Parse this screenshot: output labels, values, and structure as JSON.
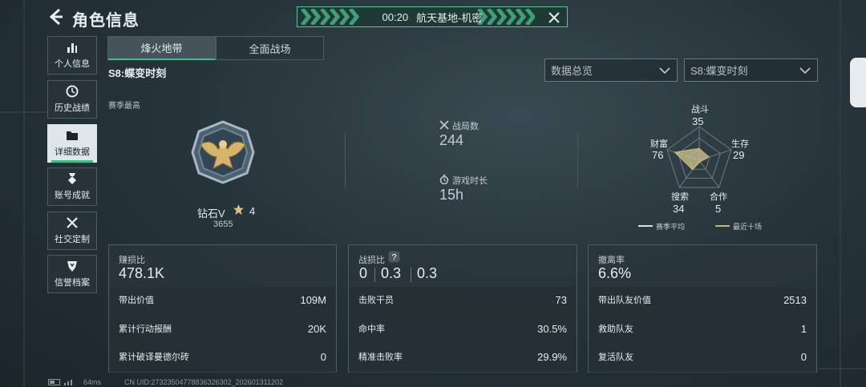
{
  "header": {
    "title": "角色信息"
  },
  "banner": {
    "time": "00:20",
    "location": "航天基地-机密"
  },
  "sidebar": {
    "items": [
      {
        "label": "个人信息",
        "icon": "bar-chart-icon"
      },
      {
        "label": "历史战绩",
        "icon": "clock-icon"
      },
      {
        "label": "详细数据",
        "icon": "folder-icon",
        "active": true
      },
      {
        "label": "账号成就",
        "icon": "medal-icon"
      },
      {
        "label": "社交定制",
        "icon": "tools-icon"
      },
      {
        "label": "信誉档案",
        "icon": "shield-icon"
      }
    ]
  },
  "tabs": [
    {
      "label": "烽火地带",
      "active": true
    },
    {
      "label": "全面战场"
    }
  ],
  "season_title": "S8:蝶变时刻",
  "dropdowns": {
    "data_view": "数据总览",
    "season": "S8:蝶变时刻"
  },
  "season_best": {
    "label": "赛季最高",
    "rank_name": "钻石V",
    "rank_stars": "4",
    "rank_score": "3655"
  },
  "stats": {
    "matches_label": "战局数",
    "matches_value": "244",
    "playtime_label": "游戏时长",
    "playtime_value": "15h"
  },
  "radar": {
    "axes": [
      {
        "label": "战斗",
        "value": "35"
      },
      {
        "label": "生存",
        "value": "29"
      },
      {
        "label": "合作",
        "value": "5"
      },
      {
        "label": "搜索",
        "value": "34"
      },
      {
        "label": "财富",
        "value": "76"
      }
    ],
    "legend": [
      {
        "label": "赛季平均",
        "color": "#d9dfe1"
      },
      {
        "label": "最近十场",
        "color": "#c9b774"
      }
    ]
  },
  "cards": {
    "profit": {
      "title": "赚损比",
      "value": "478.1K",
      "rows": [
        {
          "label": "带出价值",
          "value": "109M"
        },
        {
          "label": "累计行动报酬",
          "value": "20K"
        },
        {
          "label": "累计破译曼德尔砖",
          "value": "0"
        }
      ]
    },
    "kd": {
      "title": "战损比",
      "values": [
        "0",
        "0.3",
        "0.3"
      ],
      "rows": [
        {
          "label": "击败干员",
          "value": "73"
        },
        {
          "label": "命中率",
          "value": "30.5%"
        },
        {
          "label": "精准击败率",
          "value": "29.9%"
        }
      ]
    },
    "extract": {
      "title": "撤离率",
      "value": "6.6%",
      "rows": [
        {
          "label": "带出队友价值",
          "value": "2513"
        },
        {
          "label": "救助队友",
          "value": "1"
        },
        {
          "label": "复活队友",
          "value": "0"
        }
      ]
    }
  },
  "footer": {
    "ping": "64ms",
    "uid": "CN UID:27323504778836326302_202601311202"
  },
  "colors": {
    "accent": "#39c08a",
    "gold": "#c9b774"
  }
}
